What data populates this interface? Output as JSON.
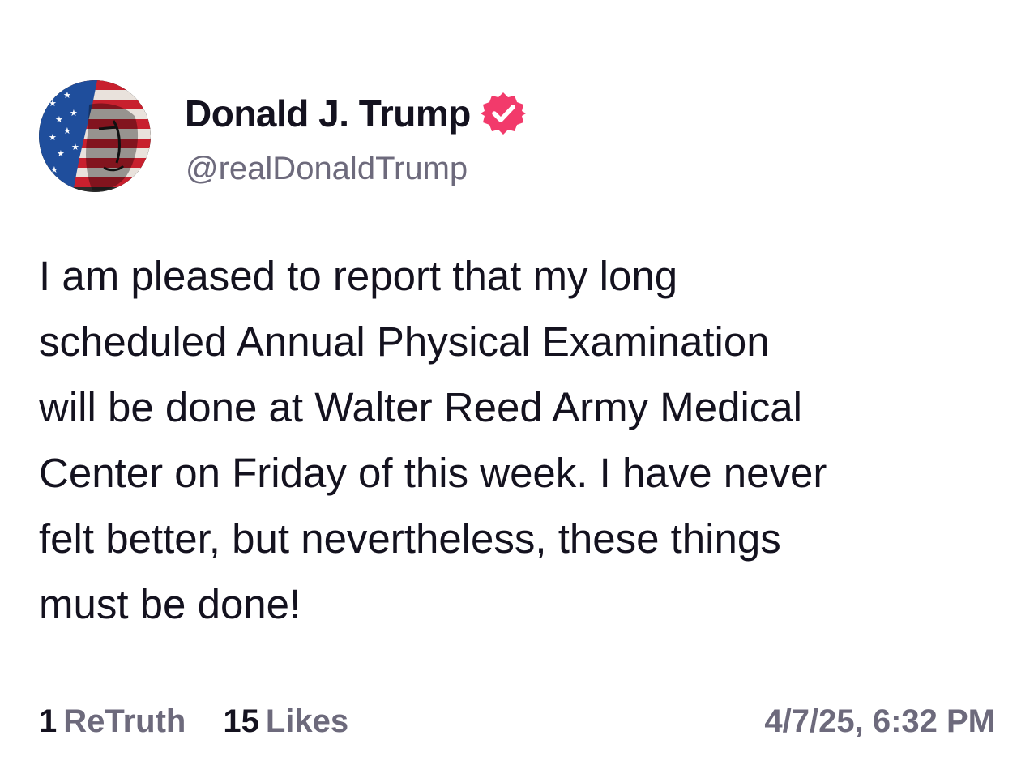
{
  "author": {
    "display_name": "Donald J. Trump",
    "handle": "@realDonaldTrump",
    "verified_icon": "verified-badge-icon",
    "verified_color": "#f23a6b",
    "avatar_icon": "avatar-flag-portrait"
  },
  "post": {
    "text": "I am pleased to report that my long\nscheduled Annual Physical Examination\nwill be done at Walter Reed Army Medical\nCenter on Friday of this week. I have never\nfelt better, but nevertheless, these things\nmust be done!"
  },
  "stats": {
    "retruths_count": "1",
    "retruths_label": "ReTruth",
    "likes_count": "15",
    "likes_label": "Likes"
  },
  "timestamp": "4/7/25, 6:32 PM",
  "colors": {
    "text": "#14121f",
    "muted": "#6d6a7c",
    "background": "#ffffff"
  }
}
